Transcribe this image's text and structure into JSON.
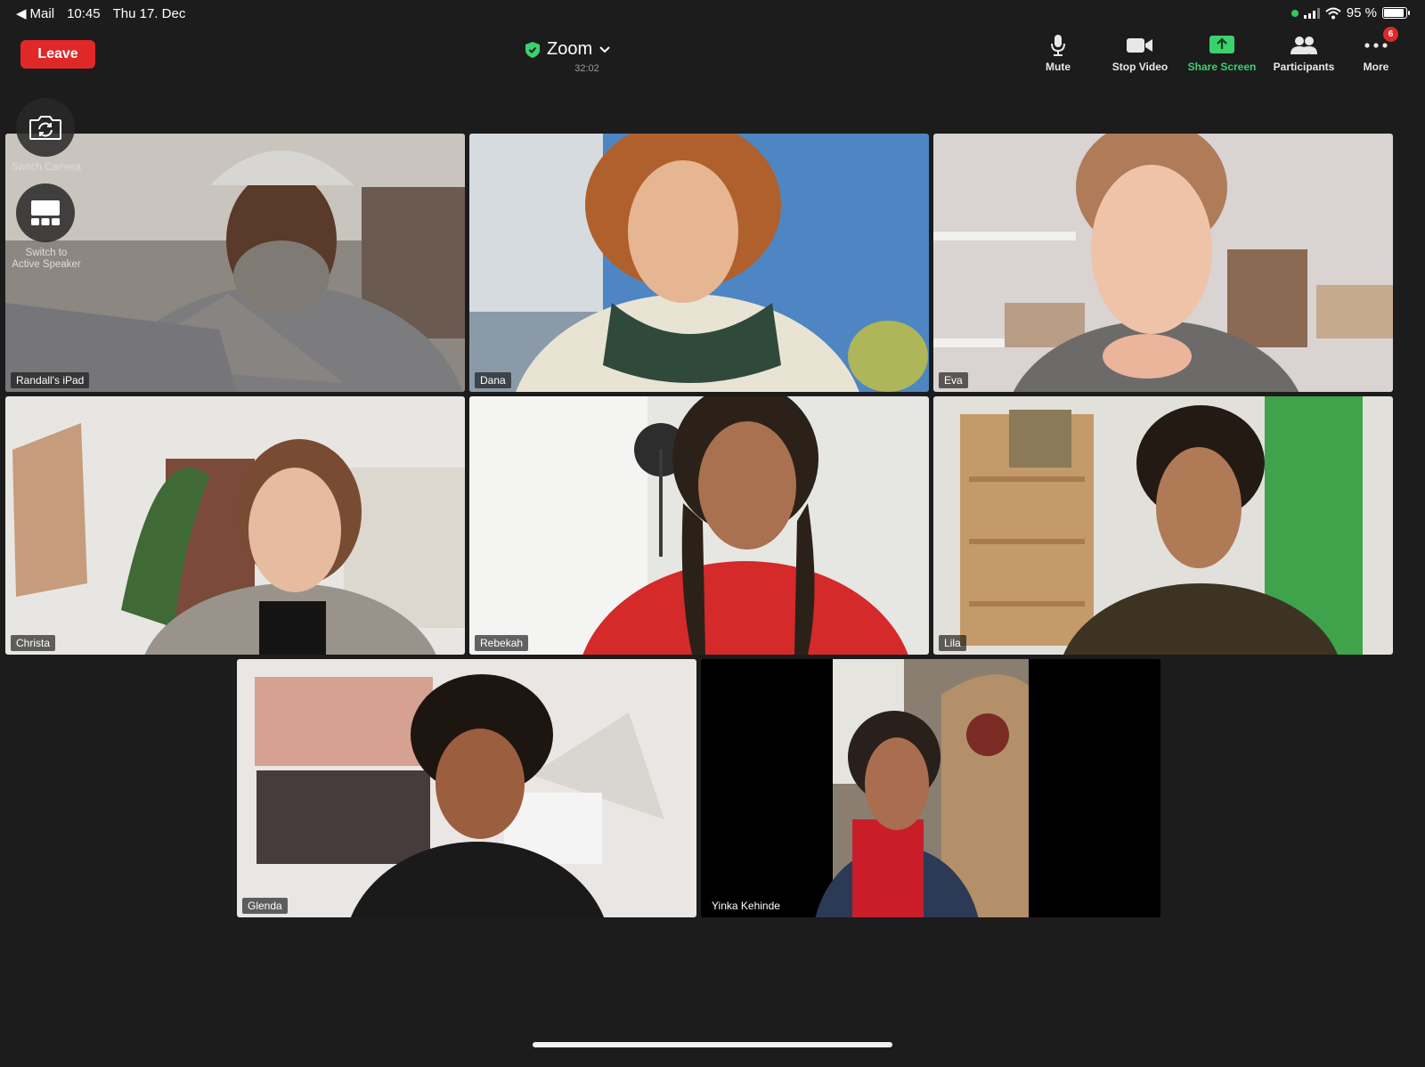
{
  "status_bar": {
    "back_app": "Mail",
    "time": "10:45",
    "date": "Thu 17. Dec",
    "battery": "95 %"
  },
  "meeting": {
    "leave_label": "Leave",
    "title": "Zoom",
    "timer": "32:02"
  },
  "toolbar": {
    "mute": "Mute",
    "stop_video": "Stop Video",
    "share_screen": "Share Screen",
    "participants": "Participants",
    "more": "More",
    "more_badge": "6"
  },
  "floating": {
    "switch_camera": "Switch Camera",
    "switch_speaker_line1": "Switch to",
    "switch_speaker_line2": "Active Speaker"
  },
  "participants": [
    {
      "name": "Randall's iPad",
      "active": true
    },
    {
      "name": "Dana"
    },
    {
      "name": "Eva"
    },
    {
      "name": "Christa"
    },
    {
      "name": "Rebekah"
    },
    {
      "name": "Lila"
    },
    {
      "name": "Glenda"
    },
    {
      "name": "Yinka Kehinde"
    }
  ],
  "colors": {
    "background": "#1c1c1c",
    "leave": "#e02828",
    "share_active": "#3bd16f",
    "active_speaker_border": "#3ecf63"
  }
}
